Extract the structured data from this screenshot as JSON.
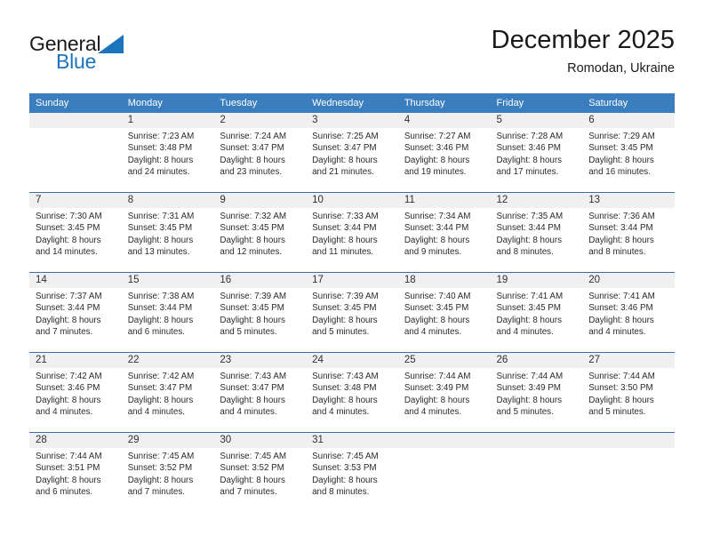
{
  "logo": {
    "text_top": "General",
    "text_bottom": "Blue",
    "accent_color": "#1c74bc",
    "triangle_icon": "triangle-icon"
  },
  "header": {
    "title": "December 2025",
    "subtitle": "Romodan, Ukraine"
  },
  "calendar": {
    "header_bg": "#3b7ec0",
    "daynum_bg": "#f0f0f0",
    "weekday_headers": [
      "Sunday",
      "Monday",
      "Tuesday",
      "Wednesday",
      "Thursday",
      "Friday",
      "Saturday"
    ],
    "weeks": [
      [
        {
          "day": "",
          "empty": true,
          "sunrise": "",
          "sunset": "",
          "daylight_1": "",
          "daylight_2": ""
        },
        {
          "day": "1",
          "sunrise": "Sunrise: 7:23 AM",
          "sunset": "Sunset: 3:48 PM",
          "daylight_1": "Daylight: 8 hours",
          "daylight_2": "and 24 minutes."
        },
        {
          "day": "2",
          "sunrise": "Sunrise: 7:24 AM",
          "sunset": "Sunset: 3:47 PM",
          "daylight_1": "Daylight: 8 hours",
          "daylight_2": "and 23 minutes."
        },
        {
          "day": "3",
          "sunrise": "Sunrise: 7:25 AM",
          "sunset": "Sunset: 3:47 PM",
          "daylight_1": "Daylight: 8 hours",
          "daylight_2": "and 21 minutes."
        },
        {
          "day": "4",
          "sunrise": "Sunrise: 7:27 AM",
          "sunset": "Sunset: 3:46 PM",
          "daylight_1": "Daylight: 8 hours",
          "daylight_2": "and 19 minutes."
        },
        {
          "day": "5",
          "sunrise": "Sunrise: 7:28 AM",
          "sunset": "Sunset: 3:46 PM",
          "daylight_1": "Daylight: 8 hours",
          "daylight_2": "and 17 minutes."
        },
        {
          "day": "6",
          "sunrise": "Sunrise: 7:29 AM",
          "sunset": "Sunset: 3:45 PM",
          "daylight_1": "Daylight: 8 hours",
          "daylight_2": "and 16 minutes."
        }
      ],
      [
        {
          "day": "7",
          "sunrise": "Sunrise: 7:30 AM",
          "sunset": "Sunset: 3:45 PM",
          "daylight_1": "Daylight: 8 hours",
          "daylight_2": "and 14 minutes."
        },
        {
          "day": "8",
          "sunrise": "Sunrise: 7:31 AM",
          "sunset": "Sunset: 3:45 PM",
          "daylight_1": "Daylight: 8 hours",
          "daylight_2": "and 13 minutes."
        },
        {
          "day": "9",
          "sunrise": "Sunrise: 7:32 AM",
          "sunset": "Sunset: 3:45 PM",
          "daylight_1": "Daylight: 8 hours",
          "daylight_2": "and 12 minutes."
        },
        {
          "day": "10",
          "sunrise": "Sunrise: 7:33 AM",
          "sunset": "Sunset: 3:44 PM",
          "daylight_1": "Daylight: 8 hours",
          "daylight_2": "and 11 minutes."
        },
        {
          "day": "11",
          "sunrise": "Sunrise: 7:34 AM",
          "sunset": "Sunset: 3:44 PM",
          "daylight_1": "Daylight: 8 hours",
          "daylight_2": "and 9 minutes."
        },
        {
          "day": "12",
          "sunrise": "Sunrise: 7:35 AM",
          "sunset": "Sunset: 3:44 PM",
          "daylight_1": "Daylight: 8 hours",
          "daylight_2": "and 8 minutes."
        },
        {
          "day": "13",
          "sunrise": "Sunrise: 7:36 AM",
          "sunset": "Sunset: 3:44 PM",
          "daylight_1": "Daylight: 8 hours",
          "daylight_2": "and 8 minutes."
        }
      ],
      [
        {
          "day": "14",
          "sunrise": "Sunrise: 7:37 AM",
          "sunset": "Sunset: 3:44 PM",
          "daylight_1": "Daylight: 8 hours",
          "daylight_2": "and 7 minutes."
        },
        {
          "day": "15",
          "sunrise": "Sunrise: 7:38 AM",
          "sunset": "Sunset: 3:44 PM",
          "daylight_1": "Daylight: 8 hours",
          "daylight_2": "and 6 minutes."
        },
        {
          "day": "16",
          "sunrise": "Sunrise: 7:39 AM",
          "sunset": "Sunset: 3:45 PM",
          "daylight_1": "Daylight: 8 hours",
          "daylight_2": "and 5 minutes."
        },
        {
          "day": "17",
          "sunrise": "Sunrise: 7:39 AM",
          "sunset": "Sunset: 3:45 PM",
          "daylight_1": "Daylight: 8 hours",
          "daylight_2": "and 5 minutes."
        },
        {
          "day": "18",
          "sunrise": "Sunrise: 7:40 AM",
          "sunset": "Sunset: 3:45 PM",
          "daylight_1": "Daylight: 8 hours",
          "daylight_2": "and 4 minutes."
        },
        {
          "day": "19",
          "sunrise": "Sunrise: 7:41 AM",
          "sunset": "Sunset: 3:45 PM",
          "daylight_1": "Daylight: 8 hours",
          "daylight_2": "and 4 minutes."
        },
        {
          "day": "20",
          "sunrise": "Sunrise: 7:41 AM",
          "sunset": "Sunset: 3:46 PM",
          "daylight_1": "Daylight: 8 hours",
          "daylight_2": "and 4 minutes."
        }
      ],
      [
        {
          "day": "21",
          "sunrise": "Sunrise: 7:42 AM",
          "sunset": "Sunset: 3:46 PM",
          "daylight_1": "Daylight: 8 hours",
          "daylight_2": "and 4 minutes."
        },
        {
          "day": "22",
          "sunrise": "Sunrise: 7:42 AM",
          "sunset": "Sunset: 3:47 PM",
          "daylight_1": "Daylight: 8 hours",
          "daylight_2": "and 4 minutes."
        },
        {
          "day": "23",
          "sunrise": "Sunrise: 7:43 AM",
          "sunset": "Sunset: 3:47 PM",
          "daylight_1": "Daylight: 8 hours",
          "daylight_2": "and 4 minutes."
        },
        {
          "day": "24",
          "sunrise": "Sunrise: 7:43 AM",
          "sunset": "Sunset: 3:48 PM",
          "daylight_1": "Daylight: 8 hours",
          "daylight_2": "and 4 minutes."
        },
        {
          "day": "25",
          "sunrise": "Sunrise: 7:44 AM",
          "sunset": "Sunset: 3:49 PM",
          "daylight_1": "Daylight: 8 hours",
          "daylight_2": "and 4 minutes."
        },
        {
          "day": "26",
          "sunrise": "Sunrise: 7:44 AM",
          "sunset": "Sunset: 3:49 PM",
          "daylight_1": "Daylight: 8 hours",
          "daylight_2": "and 5 minutes."
        },
        {
          "day": "27",
          "sunrise": "Sunrise: 7:44 AM",
          "sunset": "Sunset: 3:50 PM",
          "daylight_1": "Daylight: 8 hours",
          "daylight_2": "and 5 minutes."
        }
      ],
      [
        {
          "day": "28",
          "sunrise": "Sunrise: 7:44 AM",
          "sunset": "Sunset: 3:51 PM",
          "daylight_1": "Daylight: 8 hours",
          "daylight_2": "and 6 minutes."
        },
        {
          "day": "29",
          "sunrise": "Sunrise: 7:45 AM",
          "sunset": "Sunset: 3:52 PM",
          "daylight_1": "Daylight: 8 hours",
          "daylight_2": "and 7 minutes."
        },
        {
          "day": "30",
          "sunrise": "Sunrise: 7:45 AM",
          "sunset": "Sunset: 3:52 PM",
          "daylight_1": "Daylight: 8 hours",
          "daylight_2": "and 7 minutes."
        },
        {
          "day": "31",
          "sunrise": "Sunrise: 7:45 AM",
          "sunset": "Sunset: 3:53 PM",
          "daylight_1": "Daylight: 8 hours",
          "daylight_2": "and 8 minutes."
        },
        {
          "day": "",
          "empty": true,
          "sunrise": "",
          "sunset": "",
          "daylight_1": "",
          "daylight_2": ""
        },
        {
          "day": "",
          "empty": true,
          "sunrise": "",
          "sunset": "",
          "daylight_1": "",
          "daylight_2": ""
        },
        {
          "day": "",
          "empty": true,
          "sunrise": "",
          "sunset": "",
          "daylight_1": "",
          "daylight_2": ""
        }
      ]
    ]
  }
}
